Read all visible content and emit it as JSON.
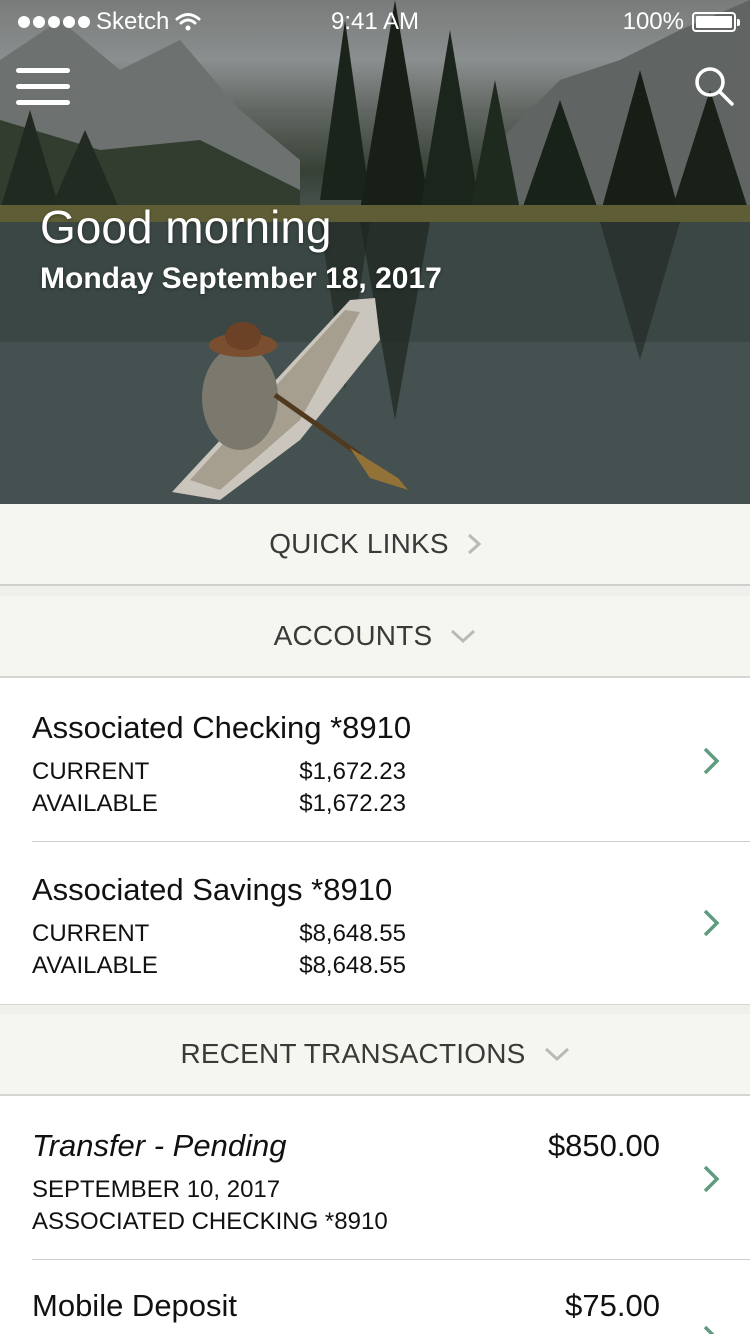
{
  "status_bar": {
    "carrier": "Sketch",
    "time": "9:41 AM",
    "battery": "100%"
  },
  "hero": {
    "greeting": "Good morning",
    "date": "Monday September 18, 2017"
  },
  "quick_links": {
    "label": "QUICK LINKS"
  },
  "accounts": {
    "label": "ACCOUNTS",
    "items": [
      {
        "name": "Associated Checking *8910",
        "current_label": "CURRENT",
        "current_value": "$1,672.23",
        "available_label": "AVAILABLE",
        "available_value": "$1,672.23"
      },
      {
        "name": "Associated Savings *8910",
        "current_label": "CURRENT",
        "current_value": "$8,648.55",
        "available_label": "AVAILABLE",
        "available_value": "$8,648.55"
      }
    ]
  },
  "recent_transactions": {
    "label": "RECENT TRANSACTIONS",
    "items": [
      {
        "title": "Transfer - Pending",
        "amount": "$850.00",
        "date": "SEPTEMBER 10, 2017",
        "account": "ASSOCIATED CHECKING *8910"
      },
      {
        "title": "Mobile Deposit",
        "amount": "$75.00"
      }
    ]
  },
  "colors": {
    "accent_green": "#5f9c7f",
    "section_bg": "#f6f6f1",
    "chevron_grey": "#b9b9b9"
  },
  "icons": [
    "menu-icon",
    "search-icon",
    "wifi-icon",
    "battery-icon",
    "chevron-right-icon",
    "chevron-down-icon"
  ]
}
